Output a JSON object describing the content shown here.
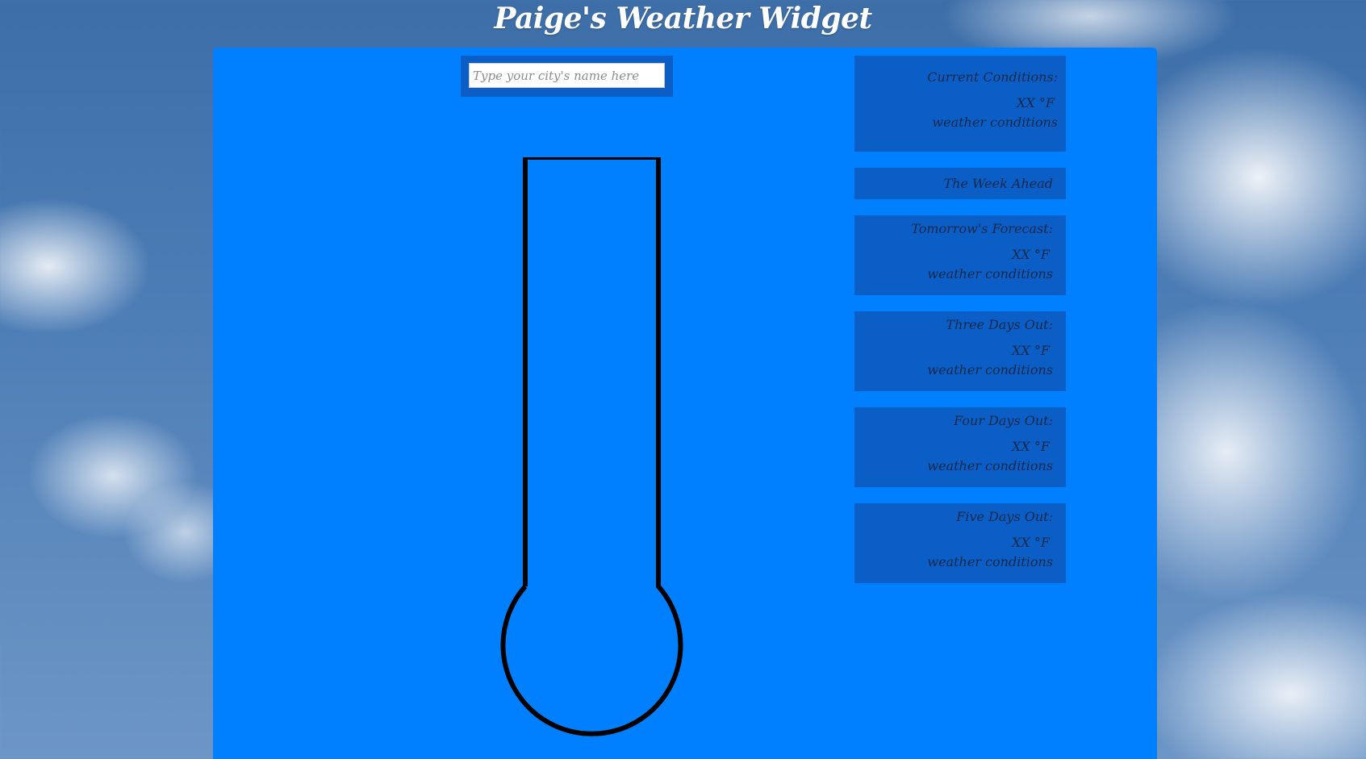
{
  "header": {
    "title": "Paige's Weather Widget"
  },
  "search": {
    "placeholder": "Type your city's name here",
    "value": ""
  },
  "current": {
    "heading": "Current Conditions:",
    "temperature": "XX °F",
    "conditions": "weather conditions"
  },
  "week_ahead": {
    "label": "The Week Ahead"
  },
  "forecast": [
    {
      "heading": "Tomorrow's Forecast:",
      "temperature": "XX °F",
      "conditions": "weather conditions"
    },
    {
      "heading": "Three Days Out:",
      "temperature": "XX °F",
      "conditions": "weather conditions"
    },
    {
      "heading": "Four Days Out:",
      "temperature": "XX °F",
      "conditions": "weather conditions"
    },
    {
      "heading": "Five Days Out:",
      "temperature": "XX °F",
      "conditions": "weather conditions"
    }
  ],
  "colors": {
    "panel": "#0080ff",
    "card": "#0a5ec6",
    "title": "#ffffff",
    "thermometer_outline": "#000000"
  }
}
